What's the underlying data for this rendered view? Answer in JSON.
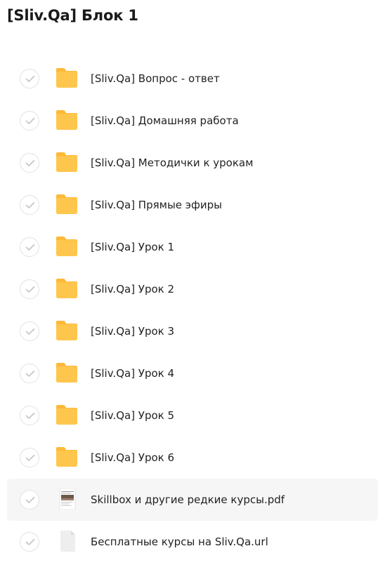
{
  "header": {
    "title": "[Sliv.Qa] Блок 1"
  },
  "colors": {
    "folder": "#ffc64d",
    "folder_tab": "#fdb937",
    "selected_row_bg": "#f6f6f6",
    "checkmark": "#c8c8c8"
  },
  "items": [
    {
      "name": "[Sliv.Qa] Вопрос - ответ",
      "type": "folder",
      "icon": "folder-icon"
    },
    {
      "name": "[Sliv.Qa] Домашняя работа",
      "type": "folder",
      "icon": "folder-icon"
    },
    {
      "name": "[Sliv.Qa] Методички к урокам",
      "type": "folder",
      "icon": "folder-icon"
    },
    {
      "name": "[Sliv.Qa] Прямые эфиры",
      "type": "folder",
      "icon": "folder-icon"
    },
    {
      "name": "[Sliv.Qa] Урок 1",
      "type": "folder",
      "icon": "folder-icon"
    },
    {
      "name": "[Sliv.Qa] Урок 2",
      "type": "folder",
      "icon": "folder-icon"
    },
    {
      "name": "[Sliv.Qa] Урок 3",
      "type": "folder",
      "icon": "folder-icon"
    },
    {
      "name": "[Sliv.Qa] Урок 4",
      "type": "folder",
      "icon": "folder-icon"
    },
    {
      "name": "[Sliv.Qa] Урок 5",
      "type": "folder",
      "icon": "folder-icon"
    },
    {
      "name": "[Sliv.Qa] Урок 6",
      "type": "folder",
      "icon": "folder-icon"
    },
    {
      "name": "Skillbox и другие редкие курсы.pdf",
      "type": "pdf",
      "icon": "pdf-thumbnail-icon",
      "selected": true
    },
    {
      "name": "Бесплатные курсы на Sliv.Qa.url",
      "type": "url",
      "icon": "file-icon"
    }
  ]
}
